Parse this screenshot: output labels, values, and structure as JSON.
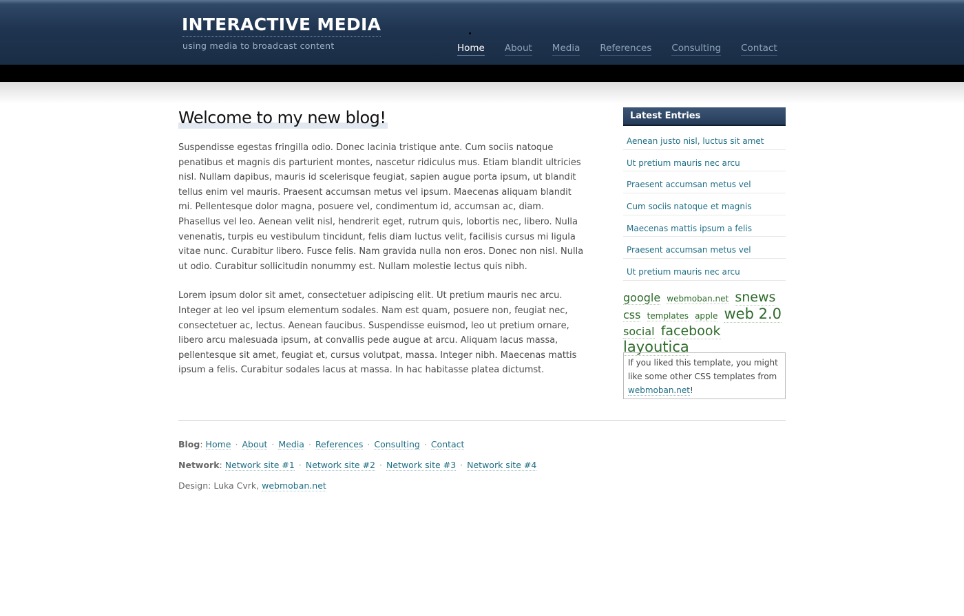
{
  "header": {
    "title": "INTERACTIVE MEDIA",
    "tagline": "using media to broadcast content",
    "nav": [
      {
        "label": "Home",
        "active": true
      },
      {
        "label": "About"
      },
      {
        "label": "Media"
      },
      {
        "label": "References"
      },
      {
        "label": "Consulting"
      },
      {
        "label": "Contact"
      }
    ]
  },
  "post": {
    "title": "Welcome to my new blog!",
    "paragraphs": [
      "Suspendisse egestas fringilla odio. Donec lacinia tristique ante. Cum sociis natoque penatibus et magnis dis parturient montes, nascetur ridiculus mus. Etiam blandit ultricies nisl. Nullam dapibus, mauris id scelerisque feugiat, sapien augue porta ipsum, ut blandit tellus enim vel mauris. Praesent accumsan metus vel ipsum. Maecenas aliquam blandit mi. Pellentesque dolor magna, posuere vel, condimentum id, accumsan ac, diam. Phasellus vel leo. Aenean velit nisl, hendrerit eget, rutrum quis, lobortis nec, libero. Nulla venenatis, turpis eu vestibulum tincidunt, felis diam luctus velit, facilisis cursus mi ligula vitae nunc. Curabitur libero. Fusce felis. Nam gravida nulla non eros. Donec non nisl. Nulla ut odio. Curabitur sollicitudin nonummy est. Nullam molestie lectus quis nibh.",
      "Lorem ipsum dolor sit amet, consectetuer adipiscing elit. Ut pretium mauris nec arcu. Integer at leo vel ipsum elementum sodales. Nam est quam, posuere non, feugiat nec, consectetuer ac, lectus. Aenean faucibus. Suspendisse euismod, leo ut pretium ornare, libero arcu malesuada ipsum, at convallis pede augue at arcu. Aliquam lacus massa, pellentesque sit amet, feugiat et, cursus volutpat, massa. Integer nibh. Maecenas mattis ipsum a felis. Curabitur sodales lacus at massa. In hac habitasse platea dictumst."
    ]
  },
  "sidebar": {
    "heading": "Latest Entries",
    "entries": [
      "Aenean justo nisl, luctus sit amet",
      "Ut pretium mauris nec arcu",
      "Praesent accumsan metus vel",
      "Cum sociis natoque et magnis",
      "Maecenas mattis ipsum a felis",
      "Praesent accumsan metus vel",
      "Ut pretium mauris nec arcu"
    ],
    "tags": [
      {
        "label": "google",
        "size": "md"
      },
      {
        "label": "webmoban.net",
        "size": "sm"
      },
      {
        "label": "snews",
        "size": "lg"
      },
      {
        "label": "css",
        "size": "md"
      },
      {
        "label": "templates",
        "size": "sm"
      },
      {
        "label": "apple",
        "size": "sm"
      },
      {
        "label": "web 2.0",
        "size": "xl"
      },
      {
        "label": "social",
        "size": "md"
      },
      {
        "label": "facebook",
        "size": "lg"
      },
      {
        "label": "layoutica",
        "size": "xl"
      }
    ],
    "promo": {
      "text": "If you liked this template, you might like some other CSS templates from ",
      "link": "webmoban.net",
      "suffix": "!"
    }
  },
  "footer": {
    "blog_label": "Blog",
    "blog_links": [
      "Home",
      "About",
      "Media",
      "References",
      "Consulting",
      "Contact"
    ],
    "network_label": "Network",
    "network_links": [
      "Network site #1",
      "Network site #2",
      "Network site #3",
      "Network site #4"
    ],
    "design_text": "Design: Luka Cvrk, ",
    "design_link": "webmoban.net"
  }
}
